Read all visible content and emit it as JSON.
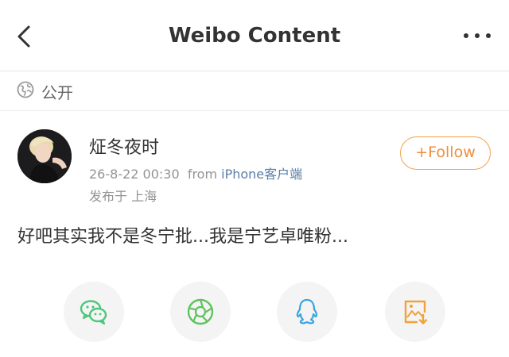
{
  "nav": {
    "title": "Weibo Content"
  },
  "visibility": {
    "label": "公开"
  },
  "post": {
    "username": "炡冬夜时",
    "date": "26-8-22 00:30",
    "from_label": "from",
    "source": "iPhone客户端",
    "location": "发布于 上海",
    "text": "好吧其实我不是冬宁批...我是宁艺卓唯粉..."
  },
  "follow_button": {
    "label": "+Follow"
  },
  "share_icons": [
    "wechat-icon",
    "moments-icon",
    "qq-icon",
    "save-image-icon"
  ],
  "colors": {
    "follow": "#f08d3a",
    "wechat": "#4dc77b",
    "moments": "#5fc35e",
    "qq": "#3aa3e0",
    "save": "#f1a23a"
  }
}
